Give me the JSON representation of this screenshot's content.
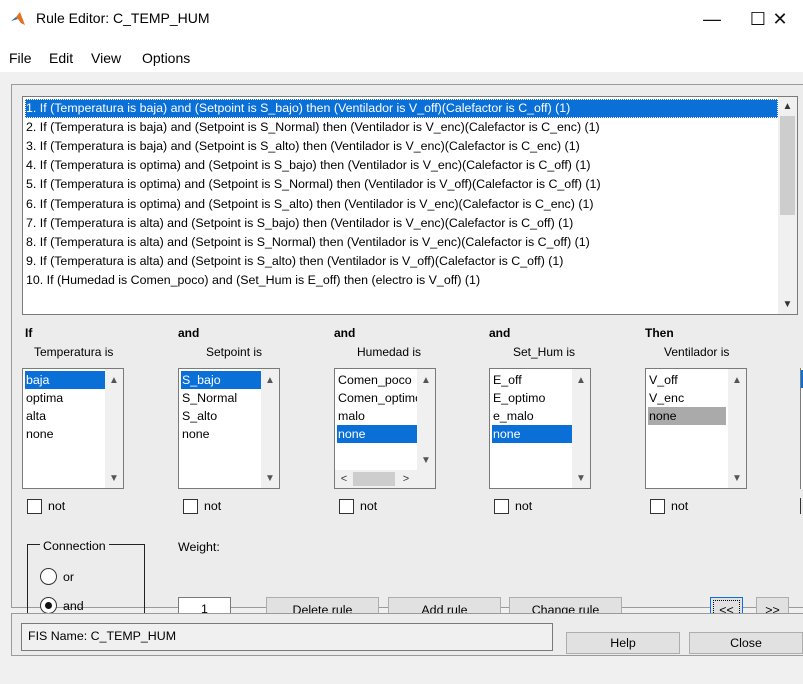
{
  "window": {
    "title": "Rule Editor: C_TEMP_HUM",
    "minimize": "—",
    "maximize": "☐",
    "close": "✕"
  },
  "menu": [
    "File",
    "Edit",
    "View",
    "Options"
  ],
  "rules": [
    "1. If (Temperatura is baja) and (Setpoint is S_bajo) then (Ventilador is V_off)(Calefactor is C_off) (1)",
    "2. If (Temperatura is baja) and (Setpoint is S_Normal) then (Ventilador is V_enc)(Calefactor is C_enc) (1)",
    "3. If (Temperatura is baja) and (Setpoint is S_alto) then (Ventilador is V_enc)(Calefactor is C_enc) (1)",
    "4. If (Temperatura is optima) and (Setpoint is S_bajo) then (Ventilador is V_enc)(Calefactor is C_off) (1)",
    "5. If (Temperatura is optima) and (Setpoint is S_Normal) then (Ventilador is V_off)(Calefactor is C_off) (1)",
    "6. If (Temperatura is optima) and (Setpoint is S_alto) then (Ventilador is V_enc)(Calefactor is C_enc) (1)",
    "7. If (Temperatura is alta) and (Setpoint is S_bajo) then (Ventilador is V_enc)(Calefactor is C_off) (1)",
    "8. If (Temperatura is alta) and (Setpoint is S_Normal) then (Ventilador is V_enc)(Calefactor is C_off) (1)",
    "9. If (Temperatura is alta) and (Setpoint is S_alto) then (Ventilador is V_off)(Calefactor is C_off) (1)",
    "10. If (Humedad is Comen_poco) and (Set_Hum is E_off) then (electro is V_off) (1)"
  ],
  "selected_rule": 0,
  "columns": [
    {
      "connector": "If",
      "label": "Temperatura is",
      "options": [
        "baja",
        "optima",
        "alta",
        "none"
      ],
      "selected": 0,
      "hscroll": false
    },
    {
      "connector": "and",
      "label": "Setpoint is",
      "options": [
        "S_bajo",
        "S_Normal",
        "S_alto",
        "none"
      ],
      "selected": 0,
      "hscroll": false
    },
    {
      "connector": "and",
      "label": "Humedad is",
      "options": [
        "Comen_poco",
        "Comen_optimo",
        "malo",
        "none"
      ],
      "selected": 3,
      "hscroll": true
    },
    {
      "connector": "and",
      "label": "Set_Hum is",
      "options": [
        "E_off",
        "E_optimo",
        "e_malo",
        "none"
      ],
      "selected": 3,
      "hscroll": false
    },
    {
      "connector": "Then",
      "label": "Ventilador is",
      "options": [
        "V_off",
        "V_enc",
        "none"
      ],
      "selected": 2,
      "hscroll": false
    }
  ],
  "not_label": "not",
  "connection": {
    "title": "Connection",
    "options": [
      "or",
      "and"
    ],
    "selected": "and"
  },
  "weight": {
    "label": "Weight:",
    "value": "1"
  },
  "buttons": {
    "delete": "Delete rule",
    "add": "Add rule",
    "change": "Change rule",
    "prev": "<<",
    "next": ">>",
    "help": "Help",
    "close": "Close"
  },
  "status": "FIS Name: C_TEMP_HUM"
}
